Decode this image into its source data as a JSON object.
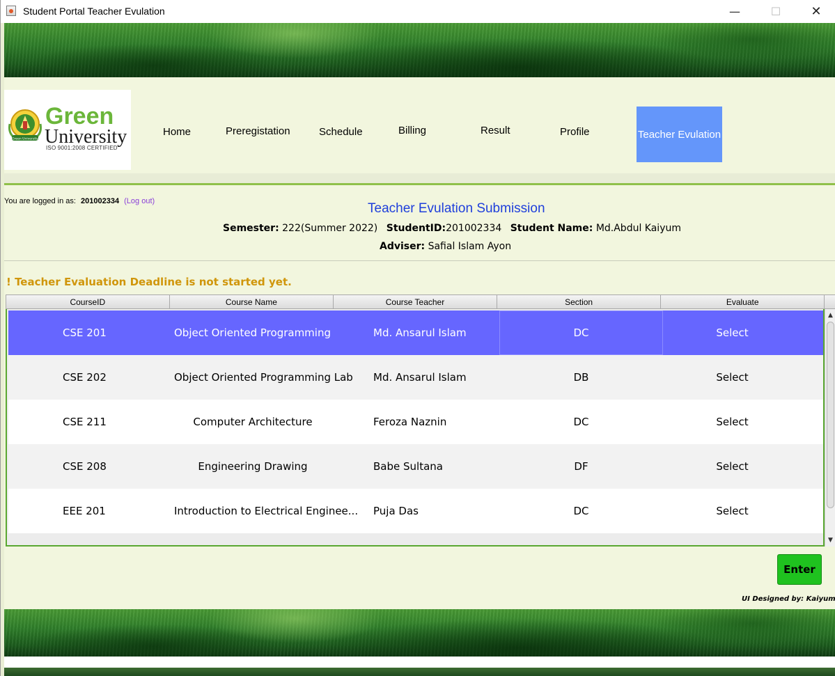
{
  "window": {
    "title": "Student Portal Teacher Evulation",
    "minimize": "—",
    "maximize": "☐",
    "close": "✕"
  },
  "logo": {
    "line1": "Green",
    "line2": "University",
    "certification": "ISO 9001:2008 CERTIFIED",
    "emblem_text": "Green University"
  },
  "nav": {
    "home": "Home",
    "preregistation": "Preregistation",
    "schedule": "Schedule",
    "billing": "Billing",
    "result": "Result",
    "profile": "Profile",
    "teacher_evulation": "Teacher Evulation",
    "active_color": "#6496fa"
  },
  "session": {
    "label": "You are logged in as:",
    "user_id": "201002334",
    "logout": "(Log out)"
  },
  "page": {
    "title": "Teacher Evulation Submission",
    "semester_label": "Semester:",
    "semester_value": "222(Summer 2022)",
    "student_id_label": "StudentID:",
    "student_id_value": "201002334",
    "student_name_label": "Student Name:",
    "student_name_value": "Md.Abdul Kaiyum",
    "adviser_label": "Adviser:",
    "adviser_value": "Safial Islam Ayon",
    "warning": "! Teacher Evaluation Deadline is not started yet.",
    "warning_color": "#d0960b"
  },
  "table": {
    "columns": [
      "CourseID",
      "Course Name",
      "Course Teacher",
      "Section",
      "Evaluate"
    ],
    "selected_color": "#6666ff",
    "rows": [
      {
        "course_id": "CSE 201",
        "course_name": "Object Oriented Programming",
        "teacher": "Md. Ansarul Islam",
        "section": "DC",
        "evaluate": "Select"
      },
      {
        "course_id": "CSE 202",
        "course_name": "Object Oriented Programming Lab",
        "teacher": "Md. Ansarul Islam",
        "section": "DB",
        "evaluate": "Select"
      },
      {
        "course_id": "CSE 211",
        "course_name": "Computer Architecture",
        "teacher": "Feroza Naznin",
        "section": "DC",
        "evaluate": "Select"
      },
      {
        "course_id": "CSE 208",
        "course_name": "Engineering Drawing",
        "teacher": "Babe Sultana",
        "section": "DF",
        "evaluate": "Select"
      },
      {
        "course_id": "EEE 201",
        "course_name": "Introduction to Electrical Enginee...",
        "teacher": "Puja Das",
        "section": "DC",
        "evaluate": "Select"
      }
    ]
  },
  "actions": {
    "enter": "Enter",
    "enter_color": "#1fc21f"
  },
  "footer": {
    "credit": "UI Designed by: Kaiyum"
  }
}
